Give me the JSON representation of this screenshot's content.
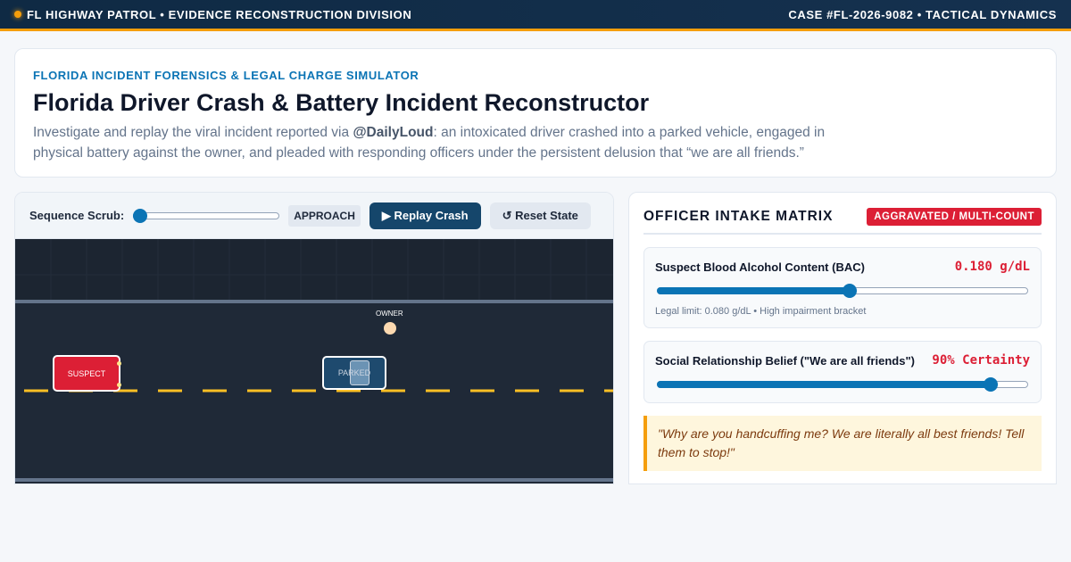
{
  "topbar": {
    "left": "FL HIGHWAY PATROL • EVIDENCE RECONSTRUCTION DIVISION",
    "right": "CASE #FL-2026-9082 • TACTICAL DYNAMICS"
  },
  "hero": {
    "eyebrow": "FLORIDA INCIDENT FORENSICS & LEGAL CHARGE SIMULATOR",
    "title": "Florida Driver Crash & Battery Incident Reconstructor",
    "desc_before": "Investigate and replay the viral incident reported via ",
    "desc_handle": "@DailyLoud",
    "desc_after": ": an intoxicated driver crashed into a parked vehicle, engaged in physical battery against the owner, and pleaded with responding officers under the persistent delusion that “we are all friends.”"
  },
  "simulator": {
    "scrub_label": "Sequence Scrub:",
    "scrub_value": 0,
    "phase": "APPROACH",
    "replay_label": "▶ Replay Crash",
    "reset_label": "↺ Reset State",
    "suspect_label": "SUSPECT",
    "parked_label": "PARKED",
    "owner_label": "OWNER"
  },
  "matrix": {
    "title": "OFFICER INTAKE MATRIX",
    "badge": "AGGRAVATED / MULTI-COUNT",
    "bac": {
      "label": "Suspect Blood Alcohol Content (BAC)",
      "value": "0.180 g/dL",
      "level": 0.52,
      "note": "Legal limit: 0.080 g/dL • High impairment bracket"
    },
    "belief": {
      "label": "Social Relationship Belief (\"We are all friends\")",
      "value": "90% Certainty",
      "level": 0.9
    },
    "quote": "\"Why are you handcuffing me? We are literally all best friends! Tell them to stop!\""
  },
  "colors": {
    "accent": "#0b74b5",
    "alert": "#dc1f35",
    "warning": "#f59e0b",
    "navy": "#0f2a44"
  }
}
